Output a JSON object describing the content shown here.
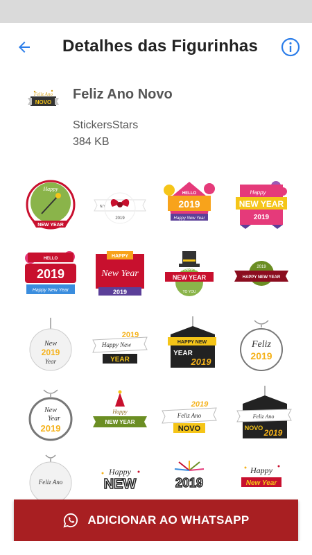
{
  "appbar": {
    "title": "Detalhes das Figurinhas",
    "back_icon": "arrow-left-icon",
    "info_icon": "info-icon",
    "accent": "#2b7de9"
  },
  "pack": {
    "name": "Feliz Ano Novo",
    "publisher": "StickersStars",
    "size": "384 KB",
    "tray_text_top": "Feliz Ano",
    "tray_text_bottom": "NOVO"
  },
  "stickers": [
    {
      "style": "green-circle",
      "t1": "Happy",
      "t2": "NEW YEAR"
    },
    {
      "style": "red-bow",
      "t1": "N.Y",
      "t2": "2019"
    },
    {
      "style": "balloon-hello",
      "t1": "HELLO",
      "t2": "2019",
      "t3": "Happy New Year"
    },
    {
      "style": "pink-newyear",
      "t1": "Happy",
      "t2": "NEW YEAR",
      "t3": "2019"
    },
    {
      "style": "hello-2019",
      "t1": "HELLO",
      "t2": "2019",
      "t3": "Happy New Year"
    },
    {
      "style": "happy-newyear-banner",
      "t1": "HAPPY",
      "t2": "New Year",
      "t3": "2019"
    },
    {
      "style": "hat-ribbon",
      "t1": "HAPPY",
      "t2": "NEW YEAR",
      "t3": "TO YOU"
    },
    {
      "style": "green-ribbon",
      "t1": "2019",
      "t2": "HAPPY NEW YEAR"
    },
    {
      "style": "ornament-new",
      "t1": "New",
      "t2": "2019",
      "t3": "Year"
    },
    {
      "style": "black-ribbon",
      "t1": "Happy New",
      "t2": "2019",
      "t3": "YEAR"
    },
    {
      "style": "hanging-tag",
      "t1": "HAPPY NEW",
      "t2": "YEAR",
      "t3": "2019"
    },
    {
      "style": "ornament-feliz",
      "t1": "Feliz",
      "t2": "2019"
    },
    {
      "style": "ornament-newyear",
      "t1": "New",
      "t2": "Year",
      "t3": "2019"
    },
    {
      "style": "party-hat",
      "t1": "Happy",
      "t2": "NEW YEAR"
    },
    {
      "style": "feliz-novo",
      "t1": "2019",
      "t2": "Feliz Ano",
      "t3": "NOVO"
    },
    {
      "style": "tag-novo",
      "t1": "Feliz Ano",
      "t2": "NOVO",
      "t3": "2019"
    },
    {
      "style": "ornament-feliz-ano",
      "t1": "Feliz Ano"
    },
    {
      "style": "happy-new-text",
      "t1": "Happy",
      "t2": "NEW"
    },
    {
      "style": "fireworks-2019",
      "t1": "2019"
    },
    {
      "style": "happy-newyear-red",
      "t1": "Happy",
      "t2": "New Year"
    }
  ],
  "action": {
    "label": "ADICIONAR AO WHATSAPP",
    "icon": "whatsapp-icon",
    "color": "#a81f22"
  }
}
